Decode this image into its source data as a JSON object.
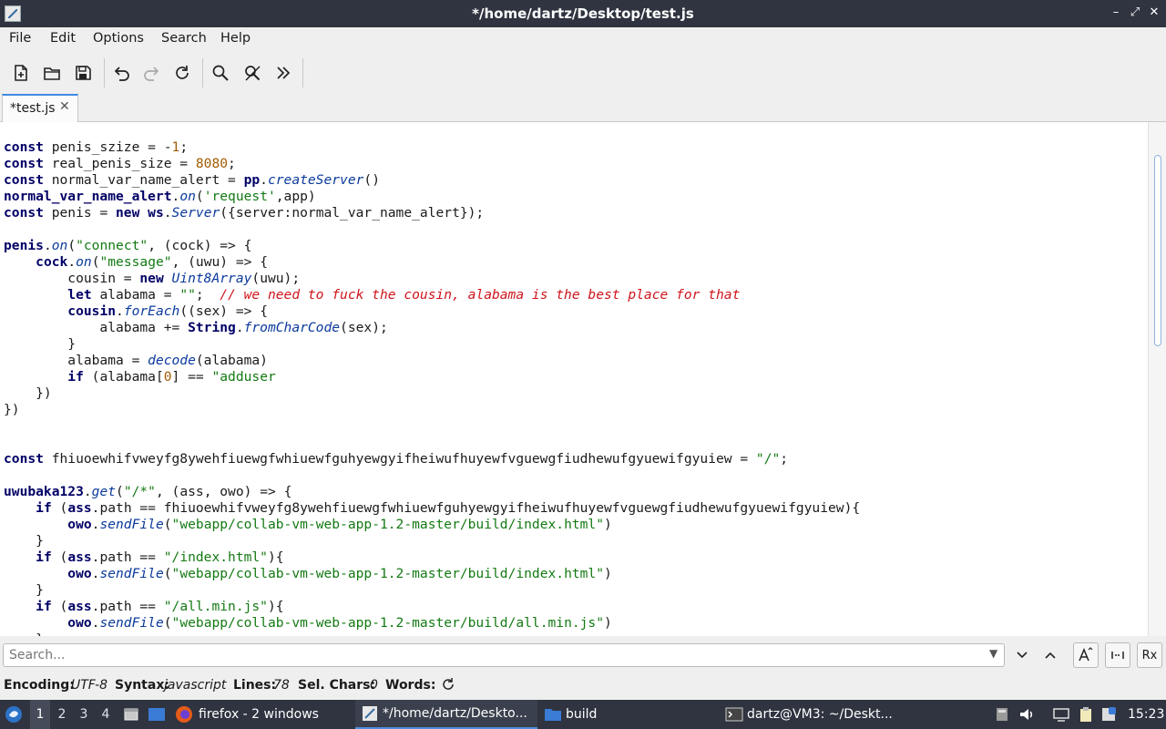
{
  "window": {
    "title": "*/home/dartz/Desktop/test.js",
    "controls": [
      "–",
      "⤢",
      "✕"
    ]
  },
  "menu": [
    "File",
    "Edit",
    "Options",
    "Search",
    "Help"
  ],
  "toolbar": {
    "icons": [
      "new-file-icon",
      "open-folder-icon",
      "save-icon",
      "undo-icon",
      "redo-icon",
      "reload-icon",
      "find-icon",
      "find-replace-icon",
      "more-icon"
    ]
  },
  "tab": {
    "label": "*test.js",
    "close": "✕"
  },
  "editor": {
    "lines": [
      [
        [
          "kw",
          "const"
        ],
        [
          "t",
          " penis_szize = -"
        ],
        [
          "num",
          "1"
        ],
        [
          "t",
          ";"
        ]
      ],
      [
        [
          "kw",
          "const"
        ],
        [
          "t",
          " real_penis_size = "
        ],
        [
          "num",
          "8080"
        ],
        [
          "t",
          ";"
        ]
      ],
      [
        [
          "kw",
          "const"
        ],
        [
          "t",
          " normal_var_name_alert = "
        ],
        [
          "kw",
          "pp"
        ],
        [
          "t",
          "."
        ],
        [
          "fn",
          "createServer"
        ],
        [
          "t",
          "()"
        ]
      ],
      [
        [
          "kw",
          "normal_var_name_alert"
        ],
        [
          "t",
          "."
        ],
        [
          "fn",
          "on"
        ],
        [
          "t",
          "("
        ],
        [
          "str",
          "'request'"
        ],
        [
          "t",
          ",app)"
        ]
      ],
      [
        [
          "kw",
          "const"
        ],
        [
          "t",
          " penis = "
        ],
        [
          "kw",
          "new"
        ],
        [
          "t",
          " "
        ],
        [
          "kw",
          "ws"
        ],
        [
          "t",
          "."
        ],
        [
          "fn",
          "Server"
        ],
        [
          "t",
          "({server:normal_var_name_alert});"
        ]
      ],
      [
        [
          "t",
          ""
        ]
      ],
      [
        [
          "kw",
          "penis"
        ],
        [
          "t",
          "."
        ],
        [
          "fn",
          "on"
        ],
        [
          "t",
          "("
        ],
        [
          "str",
          "\"connect\""
        ],
        [
          "t",
          ", (cock) => {"
        ]
      ],
      [
        [
          "t",
          "    "
        ],
        [
          "kw",
          "cock"
        ],
        [
          "t",
          "."
        ],
        [
          "fn",
          "on"
        ],
        [
          "t",
          "("
        ],
        [
          "str",
          "\"message\""
        ],
        [
          "t",
          ", (uwu) => {"
        ]
      ],
      [
        [
          "t",
          "        cousin = "
        ],
        [
          "kw",
          "new"
        ],
        [
          "t",
          " "
        ],
        [
          "fn",
          "Uint8Array"
        ],
        [
          "t",
          "(uwu);"
        ]
      ],
      [
        [
          "t",
          "        "
        ],
        [
          "kw",
          "let"
        ],
        [
          "t",
          " alabama = "
        ],
        [
          "str",
          "\"\""
        ],
        [
          "t",
          ";  "
        ],
        [
          "cm",
          "// we need to fuck the cousin, alabama is the best place for that"
        ]
      ],
      [
        [
          "t",
          "        "
        ],
        [
          "kw",
          "cousin"
        ],
        [
          "t",
          "."
        ],
        [
          "fn",
          "forEach"
        ],
        [
          "t",
          "((sex) => {"
        ]
      ],
      [
        [
          "t",
          "            alabama += "
        ],
        [
          "kw",
          "String"
        ],
        [
          "t",
          "."
        ],
        [
          "fn",
          "fromCharCode"
        ],
        [
          "t",
          "(sex);"
        ]
      ],
      [
        [
          "t",
          "        }"
        ]
      ],
      [
        [
          "t",
          "        alabama = "
        ],
        [
          "fn",
          "decode"
        ],
        [
          "t",
          "(alabama)"
        ]
      ],
      [
        [
          "t",
          "        "
        ],
        [
          "kw",
          "if"
        ],
        [
          "t",
          " (alabama["
        ],
        [
          "num",
          "0"
        ],
        [
          "t",
          "] == "
        ],
        [
          "str",
          "\"adduser"
        ]
      ],
      [
        [
          "t",
          "    })"
        ]
      ],
      [
        [
          "t",
          "})"
        ]
      ],
      [
        [
          "t",
          ""
        ]
      ],
      [
        [
          "t",
          ""
        ]
      ],
      [
        [
          "kw",
          "const"
        ],
        [
          "t",
          " fhiuoewhifvweyfg8ywehfiuewgfwhiuewfguhyewgyifheiwufhuyewfvguewgfiudhewufgyuewifgyuiew = "
        ],
        [
          "str",
          "\"/\""
        ],
        [
          "t",
          ";"
        ]
      ],
      [
        [
          "t",
          ""
        ]
      ],
      [
        [
          "kw",
          "uwubaka123"
        ],
        [
          "t",
          "."
        ],
        [
          "fn",
          "get"
        ],
        [
          "t",
          "("
        ],
        [
          "str",
          "\"/*\""
        ],
        [
          "t",
          ", (ass, owo) => {"
        ]
      ],
      [
        [
          "t",
          "    "
        ],
        [
          "kw",
          "if"
        ],
        [
          "t",
          " ("
        ],
        [
          "kw",
          "ass"
        ],
        [
          "t",
          ".path == fhiuoewhifvweyfg8ywehfiuewgfwhiuewfguhyewgyifheiwufhuyewfvguewgfiudhewufgyuewifgyuiew){"
        ]
      ],
      [
        [
          "t",
          "        "
        ],
        [
          "kw",
          "owo"
        ],
        [
          "t",
          "."
        ],
        [
          "fn",
          "sendFile"
        ],
        [
          "t",
          "("
        ],
        [
          "str",
          "\"webapp/collab-vm-web-app-1.2-master/build/index.html\""
        ],
        [
          "t",
          ")"
        ]
      ],
      [
        [
          "t",
          "    }"
        ]
      ],
      [
        [
          "t",
          "    "
        ],
        [
          "kw",
          "if"
        ],
        [
          "t",
          " ("
        ],
        [
          "kw",
          "ass"
        ],
        [
          "t",
          ".path == "
        ],
        [
          "str",
          "\"/index.html\""
        ],
        [
          "t",
          "){"
        ]
      ],
      [
        [
          "t",
          "        "
        ],
        [
          "kw",
          "owo"
        ],
        [
          "t",
          "."
        ],
        [
          "fn",
          "sendFile"
        ],
        [
          "t",
          "("
        ],
        [
          "str",
          "\"webapp/collab-vm-web-app-1.2-master/build/index.html\""
        ],
        [
          "t",
          ")"
        ]
      ],
      [
        [
          "t",
          "    }"
        ]
      ],
      [
        [
          "t",
          "    "
        ],
        [
          "kw",
          "if"
        ],
        [
          "t",
          " ("
        ],
        [
          "kw",
          "ass"
        ],
        [
          "t",
          ".path == "
        ],
        [
          "str",
          "\"/all.min.js\""
        ],
        [
          "t",
          "){"
        ]
      ],
      [
        [
          "t",
          "        "
        ],
        [
          "kw",
          "owo"
        ],
        [
          "t",
          "."
        ],
        [
          "fn",
          "sendFile"
        ],
        [
          "t",
          "("
        ],
        [
          "str",
          "\"webapp/collab-vm-web-app-1.2-master/build/all.min.js\""
        ],
        [
          "t",
          ")"
        ]
      ],
      [
        [
          "t",
          "    }"
        ]
      ]
    ]
  },
  "search": {
    "placeholder": "Search...",
    "regex_label": "Rx"
  },
  "status": {
    "encoding_label": "Encoding:",
    "encoding": "UTF-8",
    "syntax_label": "Syntax:",
    "syntax": "javascript",
    "lines_label": "Lines:",
    "lines": "78",
    "selchars_label": "Sel. Chars:",
    "selchars": "0",
    "words_label": "Words:"
  },
  "taskbar": {
    "desktops": [
      "1",
      "2",
      "3",
      "4"
    ],
    "firefox": "firefox - 2 windows",
    "editor": "*/home/dartz/Deskto...",
    "build": "build",
    "terminal": "dartz@VM3: ~/Deskt...",
    "clock": "15:23"
  }
}
